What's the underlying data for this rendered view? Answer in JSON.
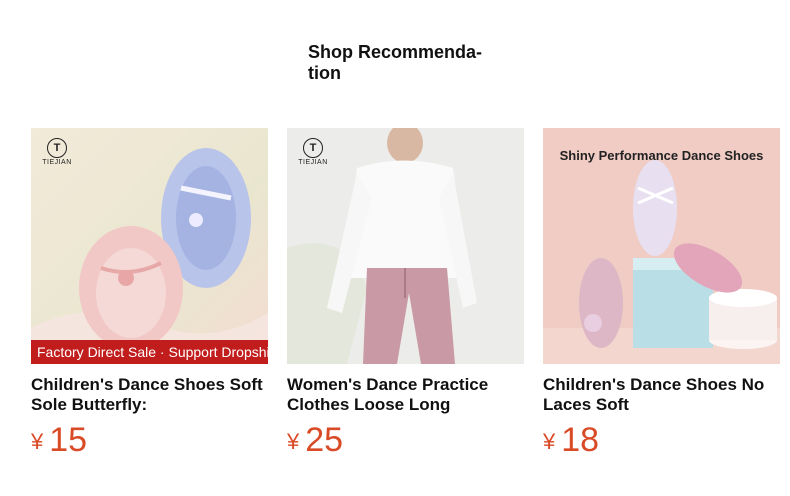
{
  "section": {
    "title": "Shop Recommenda-tion"
  },
  "products": [
    {
      "brand": "TIEJIAN",
      "banner": "Factory Direct Sale · Support Dropshipping",
      "name": "Children's Dance Shoes Soft Sole Butterfly:",
      "currency": "¥",
      "price": "15"
    },
    {
      "brand": "TIEJIAN",
      "name": "Women's Dance Practice Clothes Loose Long",
      "currency": "¥",
      "price": "25"
    },
    {
      "overlay": "Shiny Performance Dance Shoes",
      "name": "Children's Dance Shoes No Laces Soft",
      "currency": "¥",
      "price": "18"
    }
  ],
  "colors": {
    "price": "#d94a26",
    "banner": "#c21d1d"
  }
}
